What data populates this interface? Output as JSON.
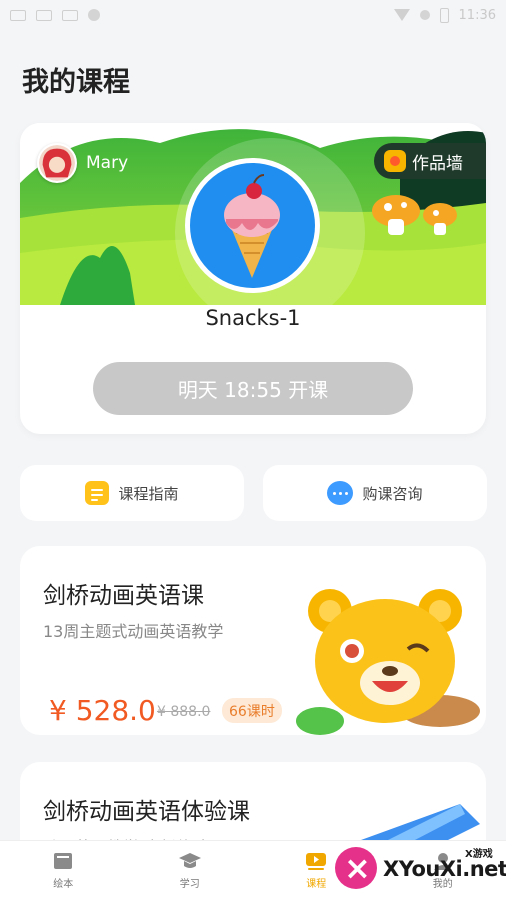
{
  "status_bar": {
    "time": "11:36"
  },
  "page": {
    "title": "我的课程"
  },
  "hero": {
    "user_name": "Mary",
    "works_wall_label": "作品墙",
    "course_name": "Snacks-1",
    "start_label": "明天 18:55 开课"
  },
  "quick_links": {
    "guide_label": "课程指南",
    "consult_label": "购课咨询"
  },
  "courses": [
    {
      "title": "剑桥动画英语课",
      "subtitle": "13周主题式动画英语教学",
      "price": "¥ 528.0",
      "original_price": "¥ 888.0",
      "lessons": "66课时"
    },
    {
      "title": "剑桥动画英语体验课",
      "subtitle": "动画英语教学 全新体验"
    }
  ],
  "tabs": [
    {
      "label": "绘本",
      "icon": "book-icon"
    },
    {
      "label": "学习",
      "icon": "graduation-cap-icon"
    },
    {
      "label": "课程",
      "icon": "play-icon",
      "active": true
    },
    {
      "label": "我的",
      "icon": "user-icon"
    }
  ],
  "watermark": {
    "text": "XYouXi.net",
    "small": "X游戏"
  },
  "colors": {
    "accent": "#f0a800",
    "price": "#f15a22",
    "grass": "#8ed83a"
  }
}
